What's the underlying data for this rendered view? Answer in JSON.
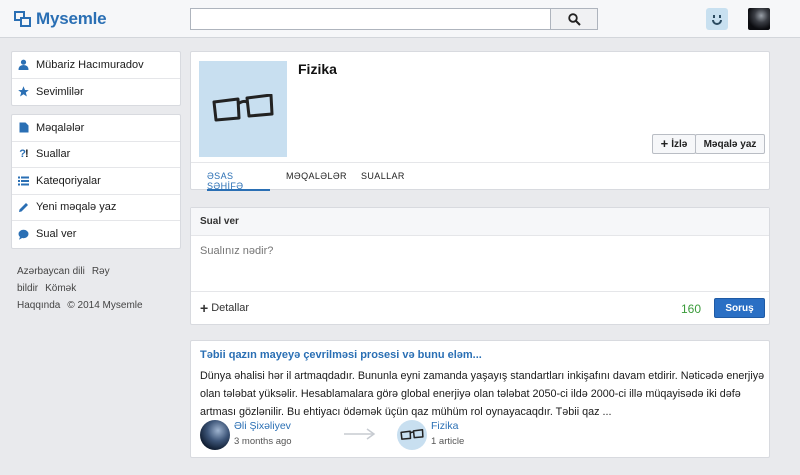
{
  "header": {
    "logo": "Mysemle",
    "search_placeholder": ""
  },
  "sidebar": {
    "user_items": [
      {
        "label": "Mübariz Hacımuradov",
        "icon": "user-icon"
      },
      {
        "label": "Sevimlilər",
        "icon": "star-icon"
      }
    ],
    "nav_items": [
      {
        "label": "Məqalələr",
        "icon": "document-icon"
      },
      {
        "label": "Suallar",
        "icon": "question-icon"
      },
      {
        "label": "Kateqoriyalar",
        "icon": "list-icon"
      },
      {
        "label": "Yeni məqalə yaz",
        "icon": "pencil-icon"
      },
      {
        "label": "Sual ver",
        "icon": "speech-bubble-icon"
      }
    ],
    "footer": [
      "Azərbaycan dili",
      "Rəy bildir",
      "Kömək",
      "Haqqında",
      "© 2014 Mysemle"
    ]
  },
  "profile": {
    "title": "Fizika",
    "follow_label": "İzlə",
    "write_label": "Məqalə yaz",
    "tabs": [
      "ƏSAS SƏHİFƏ",
      "MƏQALƏLƏR",
      "SUALLAR"
    ],
    "active_tab": 0
  },
  "ask": {
    "title": "Sual ver",
    "placeholder": "Sualınız nədir?",
    "details_label": "Detallar",
    "counter": "160",
    "submit_label": "Soruş"
  },
  "article": {
    "title": "Təbii qazın mayeyə çevrilməsi prosesi və bunu eləm...",
    "lines": [
      "Dünya əhalisi hər il artmaqdadır. Bununla eyni zamanda yaşayış standartları inkişafını davam etdirir. Nəticədə enerjiyə",
      "olan tələbat yüksəlir. Hesablamalara görə global enerjiyə olan tələbat 2050-ci ildə 2000-ci illə müqayisədə iki dəfə",
      "artması gözlənilir. Bu ehtiyacı ödəmək üçün qaz mühüm rol oynayacaqdır. Təbii qaz ..."
    ],
    "author_name": "Əli Şixəliyev",
    "author_time": "3 months ago",
    "category_name": "Fizika",
    "category_count": "1 article"
  },
  "colors": {
    "accent": "#2a6fb4",
    "counter": "#3a9b3a",
    "background": "#e9eaed"
  }
}
